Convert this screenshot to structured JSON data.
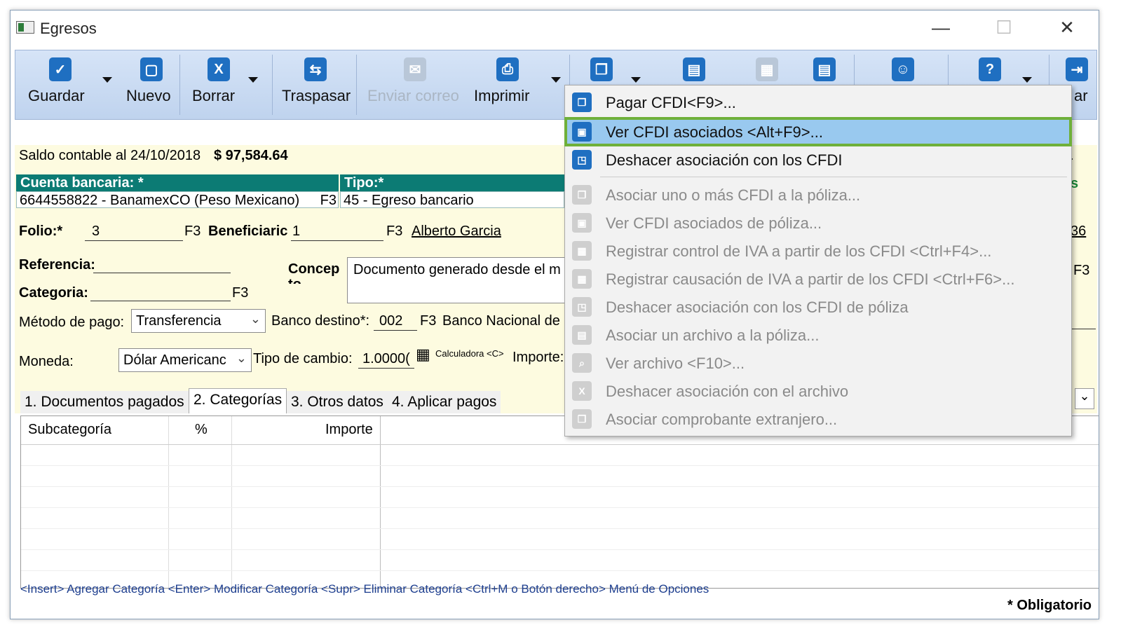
{
  "window": {
    "title": "Egresos",
    "controls": {
      "minimize": "—",
      "maximize": "☐",
      "close": "✕"
    }
  },
  "toolbar": {
    "guardar": "Guardar",
    "nuevo": "Nuevo",
    "borrar": "Borrar",
    "traspasar": "Traspasar",
    "enviar": "Enviar correo",
    "imprimir": "Imprimir",
    "right_partial": "ar"
  },
  "form": {
    "saldo_label": "Saldo contable al 24/10/2018",
    "saldo_value": "$ 97,584.64",
    "cuenta_label": "Cuenta bancaria: *",
    "cuenta_value": "6644558822 - BanamexCO (Peso Mexicano)",
    "f3": "F3",
    "tipo_label": "Tipo:*",
    "tipo_value": "45 - Egreso bancario",
    "folio_label": "Folio:*",
    "folio_value": "3",
    "beneficiario_label": "Beneficiaric",
    "beneficiario_value": "1",
    "beneficiario_name": "Alberto Garcia",
    "referencia_label": "Referencia:",
    "concepto_label": "Concep to",
    "concepto_value": "Documento generado desde el m",
    "categoria_label": "Categoria:",
    "metodo_label": "Método de pago:",
    "metodo_value": "Transferencia",
    "banco_label": "Banco destino*:",
    "banco_value": "002",
    "banco_name": "Banco Nacional de",
    "moneda_label": "Moneda:",
    "moneda_value": "Dólar Americanc",
    "tipo_cambio_label": "Tipo de cambio:",
    "tipo_cambio_value": "1.0000(",
    "calculadora": "Calculadora <C>",
    "importe_label": "Importe:",
    "right_ida": "ida",
    "right_s": "s",
    "right_36": "36",
    "right_f3": "F3"
  },
  "tabs": [
    "1. Documentos pagados",
    "2. Categorías",
    "3. Otros datos",
    "4. Aplicar pagos"
  ],
  "grid": {
    "columns": [
      "Subcategoría",
      "%",
      "Importe"
    ]
  },
  "footer": {
    "hint": "<Insert> Agregar Categoría   <Enter> Modificar Categoría   <Supr> Eliminar Categoría   <Ctrl+M o Botón derecho> Menú de Opciones",
    "obligatorio": "* Obligatorio"
  },
  "menu": {
    "items": [
      {
        "label": "Pagar CFDI<F9>...",
        "enabled": true
      },
      {
        "label": "Ver CFDI asociados <Alt+F9>...",
        "enabled": true,
        "highlighted": true
      },
      {
        "label": "Deshacer asociación con los CFDI",
        "enabled": true
      },
      {
        "label": "Asociar uno o más CFDI a la póliza...",
        "enabled": false
      },
      {
        "label": "Ver CFDI asociados de póliza...",
        "enabled": false
      },
      {
        "label": "Registrar control de IVA a partir de los CFDI <Ctrl+F4>...",
        "enabled": false
      },
      {
        "label": "Registrar causación de IVA a partir de los CFDI <Ctrl+F6>...",
        "enabled": false
      },
      {
        "label": "Deshacer asociación con los CFDI de póliza",
        "enabled": false
      },
      {
        "label": "Asociar un archivo a la póliza...",
        "enabled": false
      },
      {
        "label": "Ver archivo  <F10>...",
        "enabled": false
      },
      {
        "label": "Deshacer asociación con el archivo",
        "enabled": false
      },
      {
        "label": "Asociar comprobante extranjero...",
        "enabled": false
      }
    ]
  },
  "colors": {
    "highlight": "#99c9ef",
    "highlight_border": "#6fb03a",
    "teal": "#0c7b74",
    "form_bg": "#fdfbe0"
  }
}
